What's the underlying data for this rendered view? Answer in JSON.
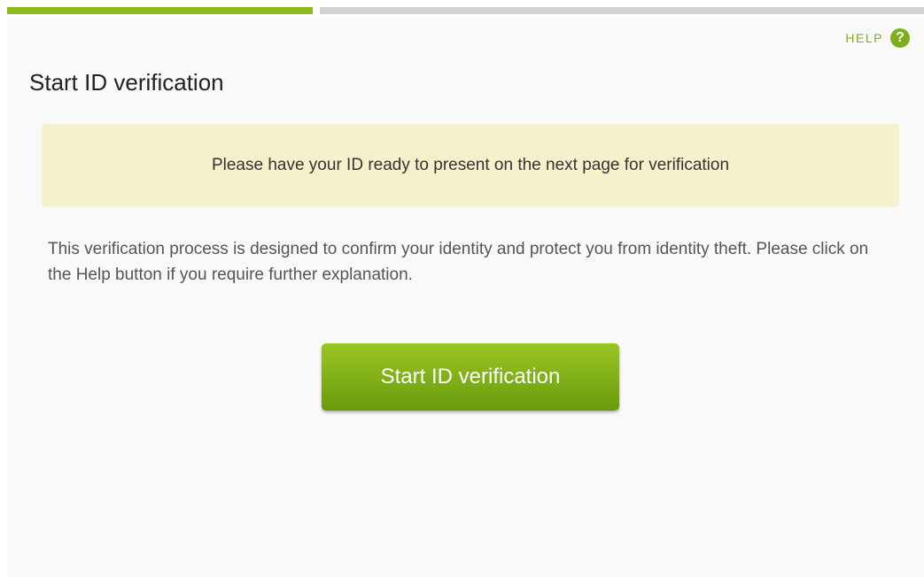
{
  "progress": {
    "completed_fraction": 0.333
  },
  "header": {
    "help_label": "HELP",
    "help_icon": "question-circle-icon",
    "help_glyph": "?"
  },
  "main": {
    "title": "Start ID verification",
    "notice": "Please have your ID ready to present on the next page for verification",
    "description": "This verification process is designed to confirm your identity and protect you from identity theft. Please click on the Help button if you require further explanation.",
    "start_button_label": "Start ID verification"
  },
  "colors": {
    "accent": "#8db91e",
    "notice_background": "#f6f1cd",
    "progress_track": "#d3d3d3"
  }
}
